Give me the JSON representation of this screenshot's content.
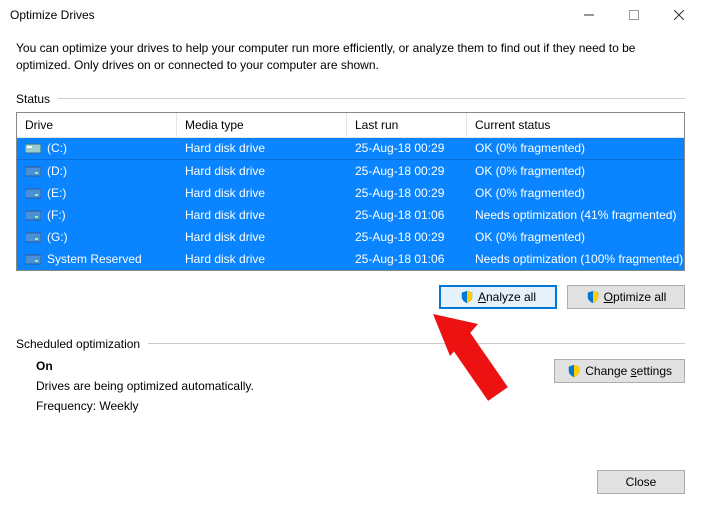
{
  "window": {
    "title": "Optimize Drives"
  },
  "description": "You can optimize your drives to help your computer run more efficiently, or analyze them to find out if they need to be optimized. Only drives on or connected to your computer are shown.",
  "sections": {
    "status": "Status",
    "scheduled": "Scheduled optimization"
  },
  "columns": {
    "drive": "Drive",
    "media": "Media type",
    "last": "Last run",
    "status": "Current status"
  },
  "drives": [
    {
      "name": "(C:)",
      "media": "Hard disk drive",
      "last": "25-Aug-18 00:29",
      "status": "OK (0% fragmented)",
      "icon": "disk"
    },
    {
      "name": "(D:)",
      "media": "Hard disk drive",
      "last": "25-Aug-18 00:29",
      "status": "OK (0% fragmented)",
      "icon": "drive"
    },
    {
      "name": "(E:)",
      "media": "Hard disk drive",
      "last": "25-Aug-18 00:29",
      "status": "OK (0% fragmented)",
      "icon": "drive"
    },
    {
      "name": "(F:)",
      "media": "Hard disk drive",
      "last": "25-Aug-18 01:06",
      "status": "Needs optimization (41% fragmented)",
      "icon": "drive"
    },
    {
      "name": "(G:)",
      "media": "Hard disk drive",
      "last": "25-Aug-18 00:29",
      "status": "OK (0% fragmented)",
      "icon": "drive"
    },
    {
      "name": "System Reserved",
      "media": "Hard disk drive",
      "last": "25-Aug-18 01:06",
      "status": "Needs optimization (100% fragmented)",
      "icon": "drive"
    }
  ],
  "buttons": {
    "analyze_pre": "A",
    "analyze_post": "nalyze all",
    "optimize_pre": "O",
    "optimize_post": "ptimize all",
    "change_pre": "Change ",
    "change_u": "s",
    "change_post": "ettings",
    "close": "Close"
  },
  "sched": {
    "on": "On",
    "auto": "Drives are being optimized automatically.",
    "freq": "Frequency: Weekly"
  }
}
